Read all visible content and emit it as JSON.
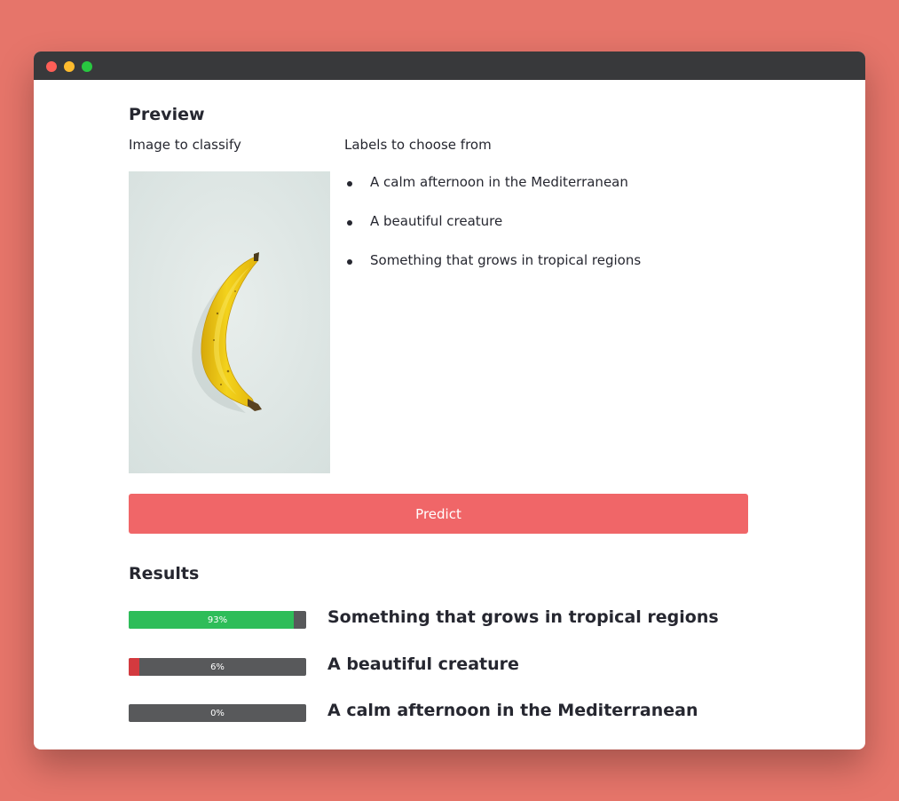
{
  "colors": {
    "background": "#e6756a",
    "titlebar": "#38393b",
    "predict_button": "#f06668",
    "bar_track": "#58595b",
    "high_confidence": "#2ebd59",
    "low_confidence": "#d33a3f"
  },
  "preview": {
    "title": "Preview",
    "image_label": "Image to classify",
    "labels_label": "Labels to choose from",
    "labels": [
      "A calm afternoon in the Mediterranean",
      "A beautiful creature",
      "Something that grows in tropical regions"
    ]
  },
  "predict_button": {
    "label": "Predict"
  },
  "results": {
    "title": "Results",
    "items": [
      {
        "percent": 93,
        "percent_label": "93%",
        "label": "Something that grows in tropical regions",
        "color": "#2ebd59"
      },
      {
        "percent": 6,
        "percent_label": "6%",
        "label": "A beautiful creature",
        "color": "#d33a3f"
      },
      {
        "percent": 0,
        "percent_label": "0%",
        "label": "A calm afternoon in the Mediterranean",
        "color": "#58595b"
      }
    ]
  }
}
